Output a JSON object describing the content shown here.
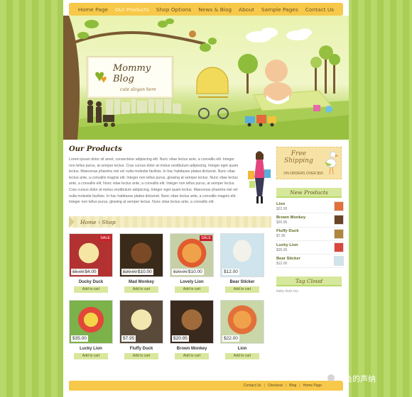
{
  "nav": {
    "items": [
      "Home Page",
      "Our Products",
      "Shop Options",
      "News & Blog",
      "About",
      "Sample Pages",
      "Contact Us"
    ]
  },
  "header": {
    "blog_title": "Mommy Blog",
    "slogan": "cute slogan here"
  },
  "main": {
    "heading": "Our Products",
    "body": "Lorem ipsum dolor sit amet, consectetur adipiscing elit. Nunc vitae lectus ante, a convallis elit. Integer non tellus purus, at semper lectus. Cras cursus dolor at metus vestibulum adipiscing. Integer eget quam lectus. Maecenas pharetra nisl vel nulla molestie facilisis. In hac habitasse platea dictumst. Nunc vitae lectus ante, a convallis magnis elit. Integer non tellus purus, glowing at semper lectus. Nunc vitae lectus ante, a convallis elit. Nunc vitae lectus ante, a convallis elit. Integer non tellus purus, at semper lectus. Cras cursus dolor at metus vestibulum adipiscing. Integer eget quam lectus. Maecenas pharetra nisl vel nulla molestie facilisis. In hac habitasse platea dictumst. Nunc vitae lectus ante, a convallis magnis elit. Integer non tellus purus, glowing at semper lectus. Nunc vitae lectus ante, a convallis elit.",
    "breadcrumb": "Home › Shop",
    "add_to_cart": "Add to cart",
    "sale_label": "SALE",
    "products": [
      {
        "name": "Ducky Duck",
        "old": "$5.00",
        "price": "$4.00",
        "sale": true
      },
      {
        "name": "Mad Monkey",
        "old": "$20.00",
        "price": "$10.00",
        "sale": false
      },
      {
        "name": "Lovely Lion",
        "old": "$20.00",
        "price": "$10.00",
        "sale": true
      },
      {
        "name": "Bear Sticker",
        "old": "",
        "price": "$12.00",
        "sale": false
      },
      {
        "name": "Lucky Lion",
        "old": "",
        "price": "$35.00",
        "sale": false
      },
      {
        "name": "Fluffy Duck",
        "old": "",
        "price": "$7.95",
        "sale": false
      },
      {
        "name": "Brown Monkey",
        "old": "",
        "price": "$20.95",
        "sale": false
      },
      {
        "name": "Lion",
        "old": "",
        "price": "$22.00",
        "sale": false
      }
    ]
  },
  "sidebar": {
    "shipping_title": "Free\nShipping",
    "shipping_sub": "ON ORDERS OVER $50",
    "new_products_heading": "New Products",
    "new_products": [
      {
        "name": "Lion",
        "price": "$22.00"
      },
      {
        "name": "Brown Monkey",
        "price": "$20.95"
      },
      {
        "name": "Fluffy Duck",
        "price": "$7.95"
      },
      {
        "name": "Lucky Lion",
        "price": "$35.00"
      },
      {
        "name": "Bear Sticker",
        "price": "$12.00"
      }
    ],
    "tag_cloud_heading": "Tag Cloud",
    "tags": "baby duck toy"
  },
  "footer": {
    "links": [
      "Contact Us",
      "Checkout",
      "Blog",
      "Home Page"
    ]
  },
  "watermark": "飞鱼的声纳",
  "colors": {
    "accent_yellow": "#f7c84a",
    "green_stripe_a": "#b8d86a",
    "green_stripe_b": "#a9cd55",
    "sale_red": "#c9222a"
  }
}
